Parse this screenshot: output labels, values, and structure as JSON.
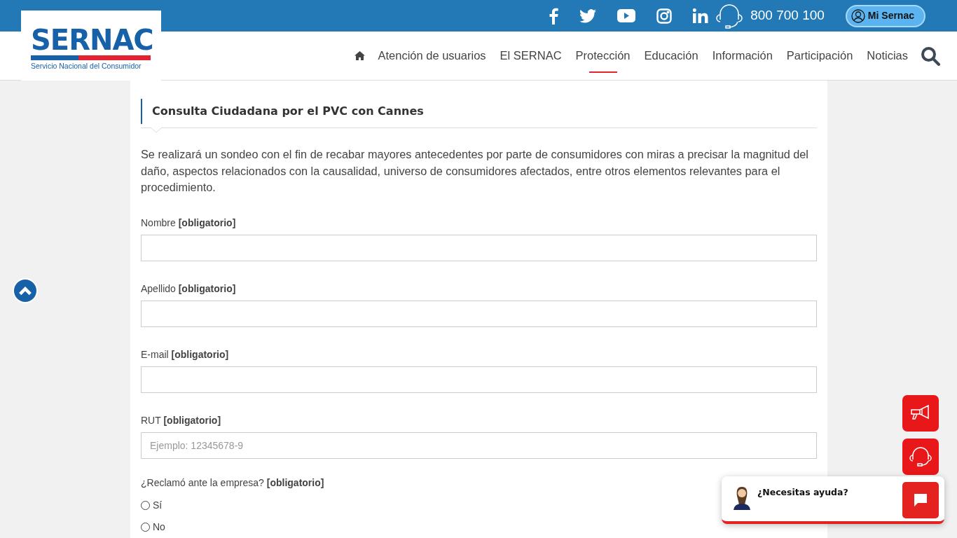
{
  "topbar": {
    "phone": "800 700 100",
    "account_button": "Mi Sernac"
  },
  "logo": {
    "title": "SERNAC",
    "subtitle": "Servicio Nacional del Consumidor"
  },
  "nav": {
    "items": [
      {
        "label": "Atención de usuarios",
        "selected": false
      },
      {
        "label": "El SERNAC",
        "selected": false
      },
      {
        "label": "Protección",
        "selected": true
      },
      {
        "label": "Educación",
        "selected": false
      },
      {
        "label": "Información",
        "selected": false
      },
      {
        "label": "Participación",
        "selected": false
      },
      {
        "label": "Noticias",
        "selected": false
      }
    ]
  },
  "form": {
    "title": "Consulta Ciudadana por el PVC con Cannes",
    "intro": "Se realizará un sondeo con el fin de recabar mayores antecedentes por parte de consumidores con miras a precisar la magnitud del daño, aspectos relacionados con la causalidad, universo de consumidores afectados, entre otros elementos relevantes para el procedimiento.",
    "fields": [
      {
        "label": "Nombre **[obligatorio]**"
      },
      {
        "label": "Apellido **[obligatorio]**"
      },
      {
        "label": "E-mail **[obligatorio]**"
      },
      {
        "label": "RUT **[obligatorio]**",
        "placeholder": "Ejemplo: 12345678-9"
      }
    ],
    "question": {
      "label": "¿Reclamó ante la empresa? **[obligatorio]**",
      "options": [
        {
          "label": "Sí",
          "selected": false
        },
        {
          "label": "No",
          "selected": false
        }
      ]
    }
  },
  "chat": {
    "prompt": "¿Necesitas ayuda?"
  }
}
